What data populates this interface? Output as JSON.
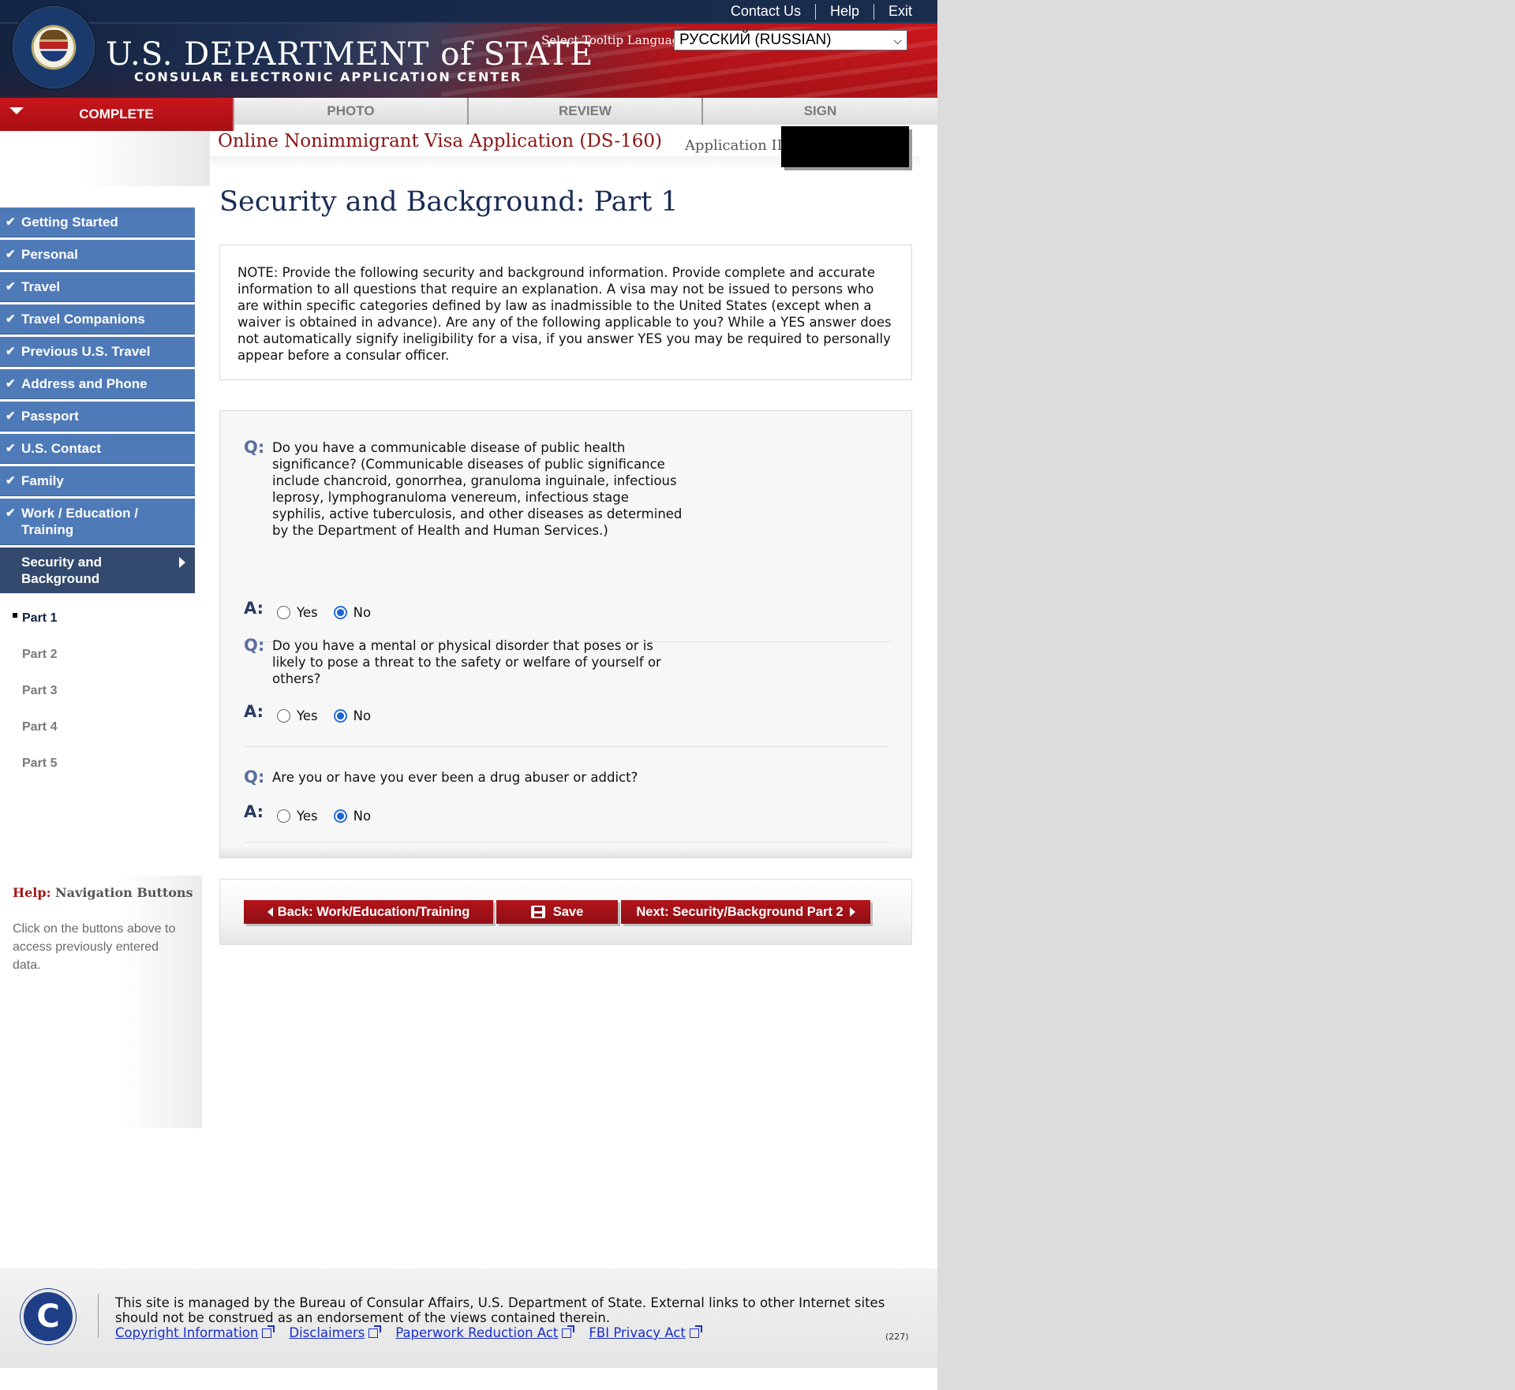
{
  "header": {
    "brand_title": "U.S. DEPARTMENT of STATE",
    "brand_subtitle": "CONSULAR ELECTRONIC APPLICATION CENTER",
    "top_links": [
      "Contact Us",
      "Help",
      "Exit"
    ],
    "language_label": "Select Tooltip Language",
    "language_selected": "РУССКИЙ (RUSSIAN)"
  },
  "tabs": [
    {
      "label": "COMPLETE",
      "active": true
    },
    {
      "label": "PHOTO",
      "active": false
    },
    {
      "label": "REVIEW",
      "active": false
    },
    {
      "label": "SIGN",
      "active": false
    }
  ],
  "sidebar": {
    "items": [
      {
        "label": "Getting Started"
      },
      {
        "label": "Personal"
      },
      {
        "label": "Travel"
      },
      {
        "label": "Travel Companions"
      },
      {
        "label": "Previous U.S. Travel"
      },
      {
        "label": "Address and Phone"
      },
      {
        "label": "Passport"
      },
      {
        "label": "U.S. Contact"
      },
      {
        "label": "Family"
      },
      {
        "label": "Work / Education / Training"
      }
    ],
    "current": "Security and Background",
    "subitems": [
      "Part 1",
      "Part 2",
      "Part 3",
      "Part 4",
      "Part 5"
    ],
    "help_title_prefix": "Help:",
    "help_title": "Navigation Buttons",
    "help_text": "Click on the buttons above to access previously entered data."
  },
  "main": {
    "app_title": "Online Nonimmigrant Visa Application (DS-160)",
    "app_id_label": "Application ID",
    "section_title": "Security and Background: Part 1",
    "note": "NOTE: Provide the following security and background information. Provide complete and accurate information to all questions that require an explanation. A visa may not be issued to persons who are within specific categories defined by law as inadmissible to the United States (except when a waiver is obtained in advance). Are any of the following applicable to you? While a YES answer does not automatically signify ineligibility for a visa, if you answer YES you may be required to personally appear before a consular officer.",
    "q_label": "Q:",
    "a_label": "A:",
    "yes_label": "Yes",
    "no_label": "No",
    "questions": [
      {
        "text": "Do you have a communicable disease of public health significance? (Communicable diseases of public significance include chancroid, gonorrhea, granuloma inguinale, infectious leprosy, lymphogranuloma venereum, infectious stage syphilis, active tuberculosis, and other diseases as determined by the Department of Health and Human Services.)",
        "answer": "No"
      },
      {
        "text": "Do you have a mental or physical disorder that poses or is likely to pose a threat to the safety or welfare of yourself or others?",
        "answer": "No"
      },
      {
        "text": "Are you or have you ever been a drug abuser or addict?",
        "answer": "No"
      }
    ]
  },
  "buttons": {
    "back": "Back: Work/Education/Training",
    "save": "Save",
    "next": "Next: Security/Background Part 2"
  },
  "footer": {
    "text": "This site is managed by the Bureau of Consular Affairs, U.S. Department of State. External links to other Internet sites should not be construed as an endorsement of the views contained therein.",
    "links": [
      "Copyright Information",
      "Disclaimers",
      "Paperwork Reduction Act",
      "FBI Privacy Act"
    ],
    "code": "(227)",
    "logo_letter": "C"
  },
  "colors": {
    "accent_red": "#b3141a",
    "nav_blue": "#4f7ab8",
    "nav_current": "#334a6e",
    "title_navy": "#1a2c55"
  }
}
